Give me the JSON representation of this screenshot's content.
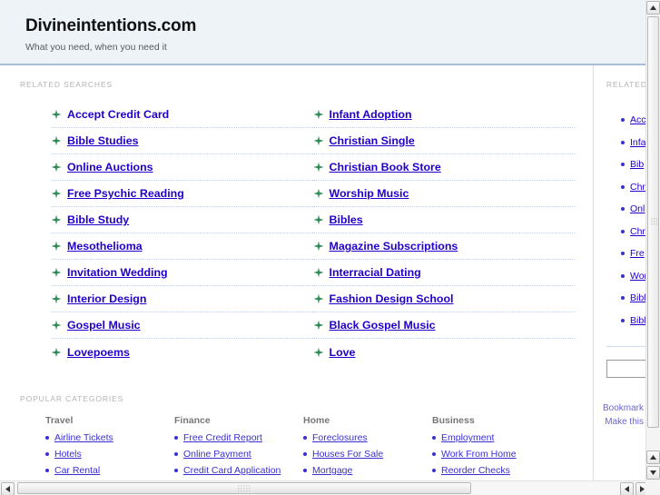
{
  "header": {
    "site_title": "Divineintentions.com",
    "tagline": "What you need, when you need it",
    "bg_color": "#eef3f8",
    "border_color": "#aabdd4"
  },
  "main": {
    "related_searches_label": "RELATED SEARCHES",
    "popular_categories_label": "POPULAR CATEGORIES",
    "link_color": "#2200cc",
    "bullet_color": "#2e8b57",
    "related_searches": {
      "left_column": [
        "Accept Credit Card",
        "Bible Studies",
        "Online Auctions",
        "Free Psychic Reading",
        "Bible Study",
        "Mesothelioma",
        "Invitation Wedding",
        "Interior Design",
        "Gospel Music",
        "Lovepoems"
      ],
      "right_column": [
        "Infant Adoption",
        "Christian Single",
        "Christian Book Store",
        "Worship Music",
        "Bibles",
        "Magazine Subscriptions",
        "Interracial Dating",
        "Fashion Design School",
        "Black Gospel Music",
        "Love"
      ]
    },
    "popular_categories": [
      {
        "heading": "Travel",
        "links": [
          "Airline Tickets",
          "Hotels",
          "Car Rental"
        ]
      },
      {
        "heading": "Finance",
        "links": [
          "Free Credit Report",
          "Online Payment",
          "Credit Card Application"
        ]
      },
      {
        "heading": "Home",
        "links": [
          "Foreclosures",
          "Houses For Sale",
          "Mortgage"
        ]
      },
      {
        "heading": "Business",
        "links": [
          "Employment",
          "Work From Home",
          "Reorder Checks"
        ]
      }
    ]
  },
  "sidebar": {
    "label": "RELATED",
    "links": [
      "Acc",
      "Infa",
      "Bib",
      "Chr",
      "Onl",
      "Chr",
      "Fre",
      "Wor",
      "Bibl",
      "Bibl"
    ],
    "search_value": "",
    "search_placeholder": "",
    "footer_links": [
      "Bookmark",
      "Make this"
    ]
  },
  "scrollbars": {
    "vertical": {
      "up_icon": "▲",
      "down_icon": "▼"
    },
    "horizontal": {
      "left_icon": "◀",
      "right_icon": "▶"
    }
  }
}
